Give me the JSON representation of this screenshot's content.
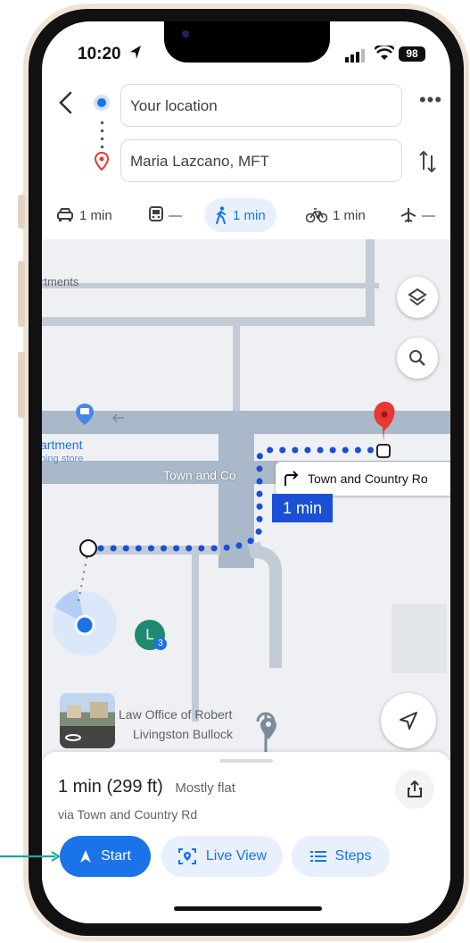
{
  "status_bar": {
    "time": "10:20",
    "battery": "98"
  },
  "directions": {
    "origin_label": "Your location",
    "destination_label": "Maria Lazcano, MFT",
    "more_label": "•••"
  },
  "modes": [
    {
      "name": "drive",
      "label": "1 min"
    },
    {
      "name": "transit",
      "label": "—"
    },
    {
      "name": "walk",
      "label": "1 min",
      "active": true
    },
    {
      "name": "bike",
      "label": "1 min"
    },
    {
      "name": "flight",
      "label": "—"
    }
  ],
  "map": {
    "place_top_left": "rtments",
    "place_pin_label": "artment",
    "place_pin_sublabel": "hing store",
    "street_label": "Town and Co",
    "turn_instruction": "Town and Country Ro",
    "eta_badge": "1 min",
    "poi_label_line1": "Law Office of Robert",
    "poi_label_line2": "Livingston Bullock",
    "marker_letter": "L",
    "marker_count": "3"
  },
  "sheet": {
    "duration": "1 min",
    "distance": "(299 ft)",
    "terrain": "Mostly flat",
    "via": "via Town and Country Rd",
    "start_label": "Start",
    "live_view_label": "Live View",
    "steps_label": "Steps"
  },
  "colors": {
    "accent": "#1a73e8",
    "route": "#1a4fd6",
    "destination_pin": "#e53935",
    "chip_bg": "#e8f0fe",
    "callout_arrow": "#1aa99c"
  }
}
